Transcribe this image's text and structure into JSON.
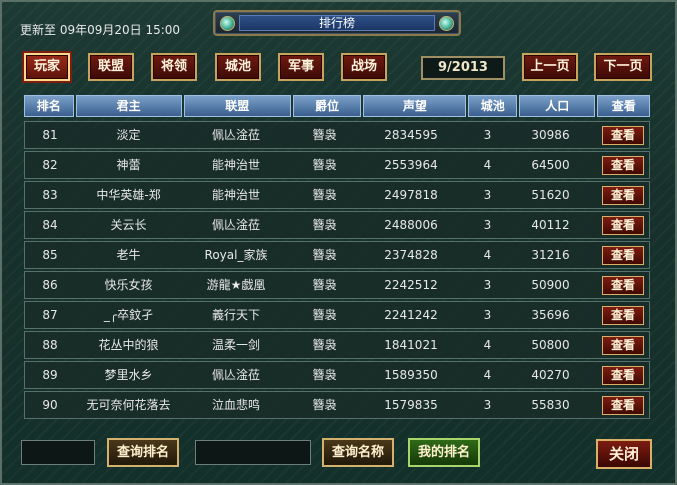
{
  "header": {
    "update_text": "更新至 09年09月20日 15:00",
    "title": "排行榜"
  },
  "tabs": [
    {
      "label": "玩家",
      "active": true
    },
    {
      "label": "联盟",
      "active": false
    },
    {
      "label": "将领",
      "active": false
    },
    {
      "label": "城池",
      "active": false
    },
    {
      "label": "军事",
      "active": false
    },
    {
      "label": "战场",
      "active": false
    }
  ],
  "pagination": {
    "page_text": "9/2013",
    "prev_label": "上一页",
    "next_label": "下一页"
  },
  "table": {
    "columns": [
      "排名",
      "君主",
      "联盟",
      "爵位",
      "声望",
      "城池",
      "人口",
      "查看"
    ],
    "view_label": "查看",
    "rows": [
      [
        "81",
        "淡定",
        "佩亾淦莅",
        "簪袅",
        "2834595",
        "3",
        "30986"
      ],
      [
        "82",
        "神蕾",
        "能神治世",
        "簪袅",
        "2553964",
        "4",
        "64500"
      ],
      [
        "83",
        "中华英雄-郑",
        "能神治世",
        "簪袅",
        "2497818",
        "3",
        "51620"
      ],
      [
        "84",
        "关云长",
        "佩亾淦莅",
        "簪袅",
        "2488006",
        "3",
        "40112"
      ],
      [
        "85",
        "老牛",
        "Royal_家族",
        "簪袅",
        "2374828",
        "4",
        "31216"
      ],
      [
        "86",
        "快乐女孩",
        "游龍★戯凰",
        "簪袅",
        "2242512",
        "3",
        "50900"
      ],
      [
        "87",
        "_╭卒鈫孑",
        "義行天下",
        "簪袅",
        "2241242",
        "3",
        "35696"
      ],
      [
        "88",
        "花丛中的狼",
        "温柔一剑",
        "簪袅",
        "1841021",
        "4",
        "50800"
      ],
      [
        "89",
        "梦里水乡",
        "佩亾淦莅",
        "簪袅",
        "1589350",
        "4",
        "40270"
      ],
      [
        "90",
        "无可奈何花落去",
        "泣血悲鸣",
        "簪袅",
        "1579835",
        "3",
        "55830"
      ]
    ]
  },
  "footer": {
    "rank_input_value": "",
    "query_rank_label": "查询排名",
    "name_input_value": "",
    "query_name_label": "查询名称",
    "my_rank_label": "我的排名",
    "close_label": "关闭"
  }
}
